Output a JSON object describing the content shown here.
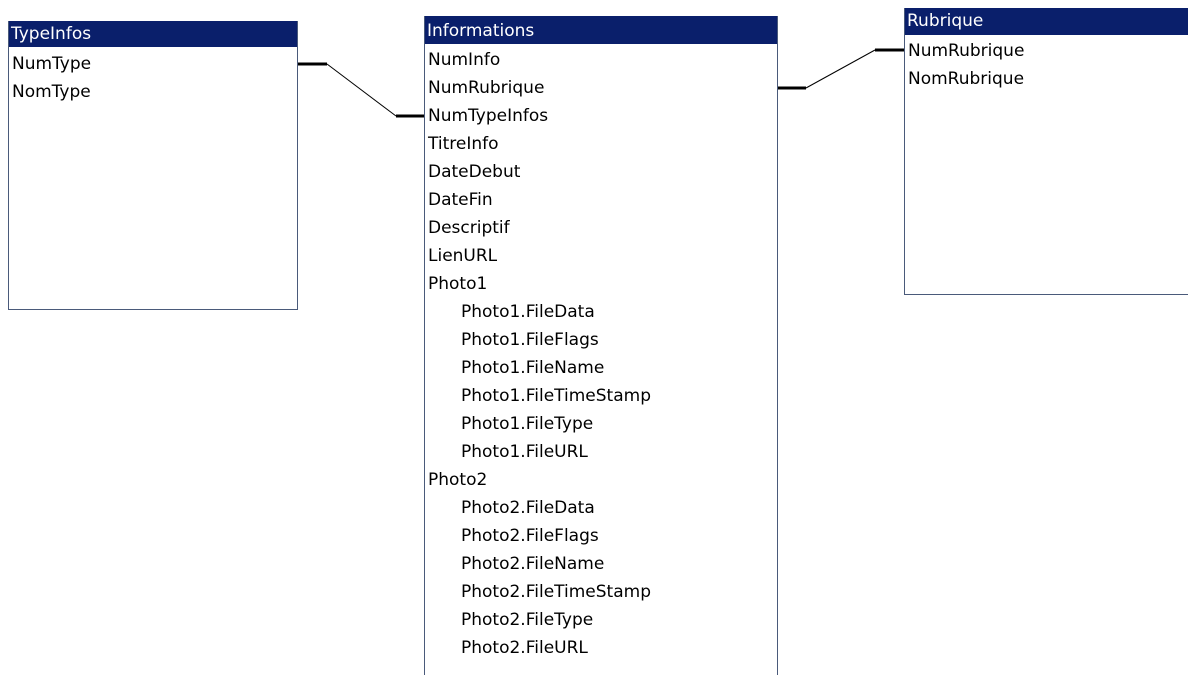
{
  "tables": {
    "typeinfos": {
      "title": "TypeInfos",
      "fields": [
        "NumType",
        "NomType"
      ]
    },
    "informations": {
      "title": "Informations",
      "fields": [
        {
          "label": "NumInfo",
          "sub": false
        },
        {
          "label": "NumRubrique",
          "sub": false
        },
        {
          "label": "NumTypeInfos",
          "sub": false
        },
        {
          "label": "TitreInfo",
          "sub": false
        },
        {
          "label": "DateDebut",
          "sub": false
        },
        {
          "label": "DateFin",
          "sub": false
        },
        {
          "label": "Descriptif",
          "sub": false
        },
        {
          "label": "LienURL",
          "sub": false
        },
        {
          "label": "Photo1",
          "sub": false
        },
        {
          "label": "Photo1.FileData",
          "sub": true
        },
        {
          "label": "Photo1.FileFlags",
          "sub": true
        },
        {
          "label": "Photo1.FileName",
          "sub": true
        },
        {
          "label": "Photo1.FileTimeStamp",
          "sub": true
        },
        {
          "label": "Photo1.FileType",
          "sub": true
        },
        {
          "label": "Photo1.FileURL",
          "sub": true
        },
        {
          "label": "Photo2",
          "sub": false
        },
        {
          "label": "Photo2.FileData",
          "sub": true
        },
        {
          "label": "Photo2.FileFlags",
          "sub": true
        },
        {
          "label": "Photo2.FileName",
          "sub": true
        },
        {
          "label": "Photo2.FileTimeStamp",
          "sub": true
        },
        {
          "label": "Photo2.FileType",
          "sub": true
        },
        {
          "label": "Photo2.FileURL",
          "sub": true
        }
      ]
    },
    "rubrique": {
      "title": "Rubrique",
      "fields": [
        "NumRubrique",
        "NomRubrique"
      ]
    }
  },
  "relationships": [
    {
      "from_table": "TypeInfos",
      "from_field": "NumType",
      "to_table": "Informations",
      "to_field": "NumTypeInfos"
    },
    {
      "from_table": "Rubrique",
      "from_field": "NumRubrique",
      "to_table": "Informations",
      "to_field": "NumRubrique"
    }
  ],
  "colors": {
    "title_bar": "#0a1f6b",
    "title_text": "#ffffff",
    "border": "#4a5a7a",
    "line": "#000000"
  }
}
